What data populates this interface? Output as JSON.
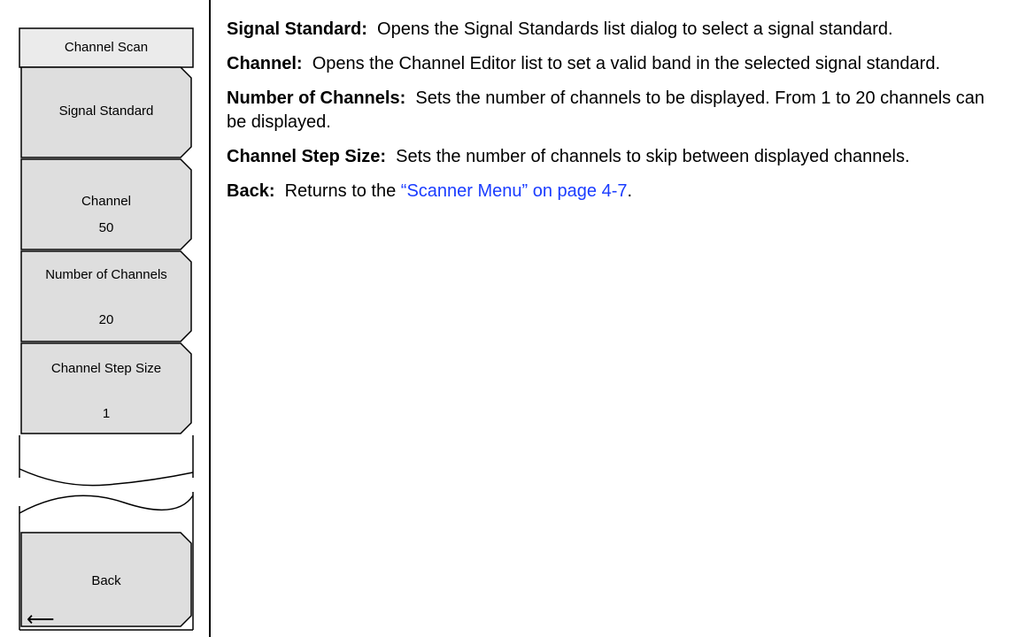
{
  "menu": {
    "title": "Channel Scan",
    "keys": [
      {
        "label": "Signal Standard",
        "value": ""
      },
      {
        "label": "Channel",
        "value": "50"
      },
      {
        "label": "Number of Channels",
        "value": "20"
      },
      {
        "label": "Channel Step Size",
        "value": "1"
      },
      {
        "label": "Back",
        "value": ""
      }
    ],
    "back_arrow": "⟵"
  },
  "descriptions": [
    {
      "term": "Signal Standard:",
      "text": "Opens the Signal Standards list dialog to select a signal standard."
    },
    {
      "term": "Channel:",
      "text": "Opens the Channel Editor list to set a valid band in the selected signal standard."
    },
    {
      "term": "Number of Channels:",
      "text": "Sets the number of channels to be displayed. From 1 to 20 channels can be displayed."
    },
    {
      "term": "Channel Step Size:",
      "text": "Sets the number of channels to skip between displayed channels."
    },
    {
      "term": "Back:",
      "text": "Returns to the",
      "link": "“Scanner Menu” on page 4-7",
      "after": "."
    }
  ]
}
